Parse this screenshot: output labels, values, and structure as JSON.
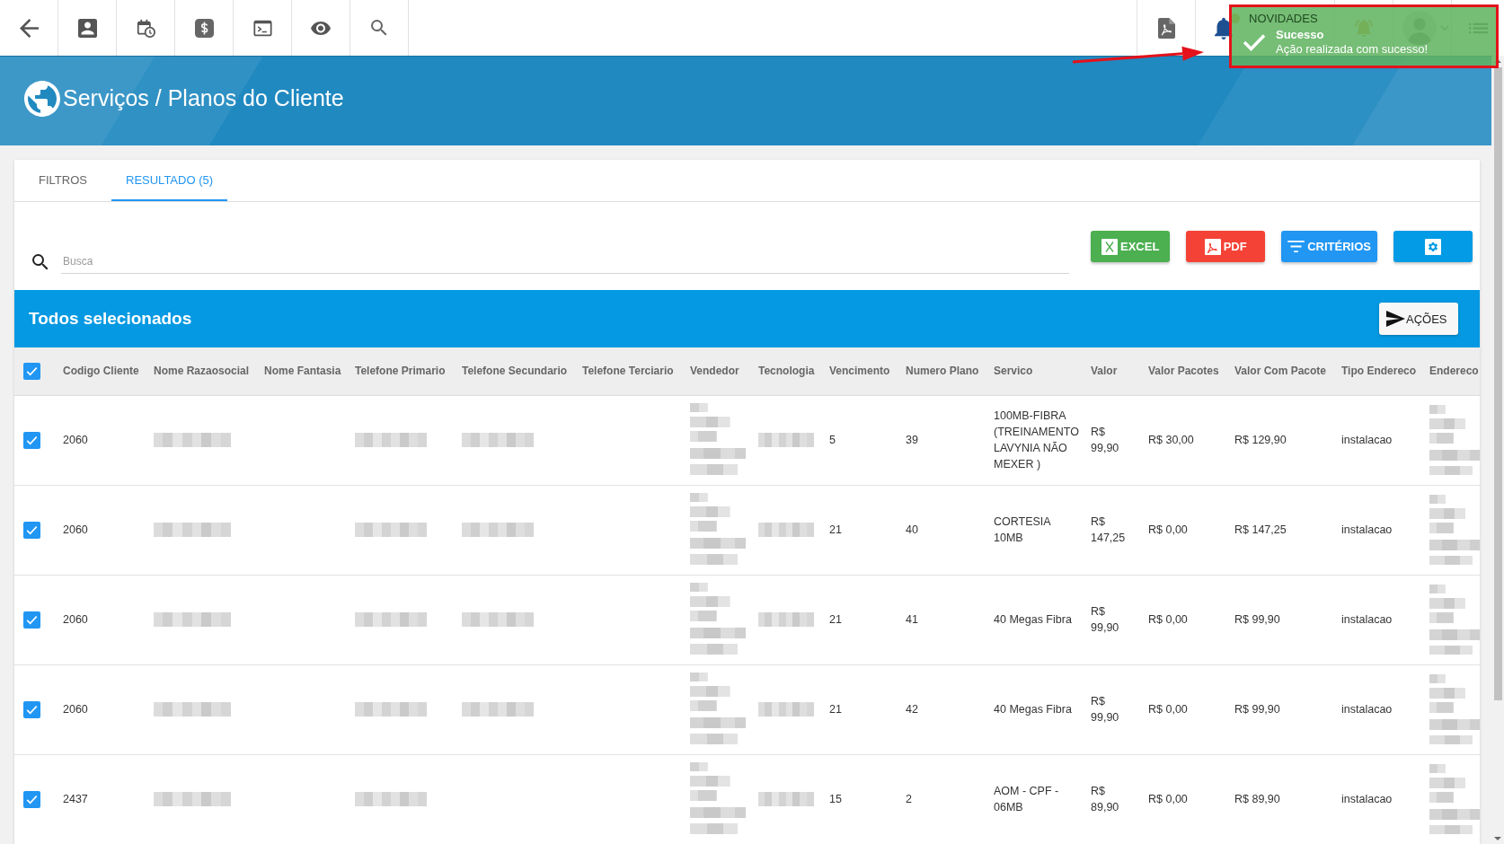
{
  "topbar": {
    "news_label": "NOVIDADES"
  },
  "toast": {
    "title": "Sucesso",
    "message": "Ação realizada com sucesso!"
  },
  "page_title": "Serviços / Planos do Cliente",
  "tabs": [
    {
      "label": "FILTROS",
      "selected": false
    },
    {
      "label": "RESULTADO (5)",
      "selected": true
    }
  ],
  "search": {
    "placeholder": "Busca"
  },
  "actions": [
    {
      "kind": "excel",
      "label": "EXCEL"
    },
    {
      "kind": "pdf",
      "label": "PDF"
    },
    {
      "kind": "criteria",
      "label": "CRITÉRIOS"
    },
    {
      "kind": "settings"
    }
  ],
  "selection_bar": {
    "title": "Todos selecionados",
    "button_label": "AÇÕES"
  },
  "table": {
    "select_all": {
      "checked": true
    },
    "columns": [
      "Codigo Cliente",
      "Nome Razaosocial",
      "Nome Fantasia",
      "Telefone Primario",
      "Telefone Secundario",
      "Telefone Terciario",
      "Vendedor",
      "Tecnologia",
      "Vencimento",
      "Numero Plano",
      "Servico",
      "Valor",
      "Valor Pacotes",
      "Valor Com Pacote",
      "Tipo Endereco",
      "Endereco"
    ],
    "rows": [
      {
        "checked": true,
        "cells": [
          {
            "kind": "text",
            "text": "2060"
          },
          {
            "kind": "blurred"
          },
          null,
          {
            "kind": "blurred"
          },
          {
            "kind": "blurred"
          },
          null,
          {
            "kind": "blurred_lines"
          },
          {
            "kind": "blurred"
          },
          {
            "kind": "text",
            "text": "5"
          },
          {
            "kind": "text",
            "text": "39"
          },
          {
            "kind": "text",
            "text": "100MB-FIBRA (TREINAMENTO LAVYNIA NÃO MEXER )"
          },
          {
            "kind": "text",
            "text": "R$ 99,90"
          },
          {
            "kind": "text",
            "text": "R$ 30,00"
          },
          {
            "kind": "text",
            "text": "R$ 129,90"
          },
          {
            "kind": "text",
            "text": "instalacao"
          },
          {
            "kind": "blurred_lines"
          }
        ]
      },
      {
        "checked": true,
        "cells": [
          {
            "kind": "text",
            "text": "2060"
          },
          {
            "kind": "blurred"
          },
          null,
          {
            "kind": "blurred"
          },
          {
            "kind": "blurred"
          },
          null,
          {
            "kind": "blurred_lines"
          },
          {
            "kind": "blurred"
          },
          {
            "kind": "text",
            "text": "21"
          },
          {
            "kind": "text",
            "text": "40"
          },
          {
            "kind": "text",
            "text": "CORTESIA 10MB"
          },
          {
            "kind": "text",
            "text": "R$ 147,25"
          },
          {
            "kind": "text",
            "text": "R$ 0,00"
          },
          {
            "kind": "text",
            "text": "R$ 147,25"
          },
          {
            "kind": "text",
            "text": "instalacao"
          },
          {
            "kind": "blurred_lines"
          }
        ]
      },
      {
        "checked": true,
        "cells": [
          {
            "kind": "text",
            "text": "2060"
          },
          {
            "kind": "blurred"
          },
          null,
          {
            "kind": "blurred"
          },
          {
            "kind": "blurred"
          },
          null,
          {
            "kind": "blurred_lines"
          },
          {
            "kind": "blurred"
          },
          {
            "kind": "text",
            "text": "21"
          },
          {
            "kind": "text",
            "text": "41"
          },
          {
            "kind": "text",
            "text": "40 Megas Fibra"
          },
          {
            "kind": "text",
            "text": "R$ 99,90"
          },
          {
            "kind": "text",
            "text": "R$ 0,00"
          },
          {
            "kind": "text",
            "text": "R$ 99,90"
          },
          {
            "kind": "text",
            "text": "instalacao"
          },
          {
            "kind": "blurred_lines"
          }
        ]
      },
      {
        "checked": true,
        "cells": [
          {
            "kind": "text",
            "text": "2060"
          },
          {
            "kind": "blurred"
          },
          null,
          {
            "kind": "blurred"
          },
          {
            "kind": "blurred"
          },
          null,
          {
            "kind": "blurred_lines"
          },
          {
            "kind": "blurred"
          },
          {
            "kind": "text",
            "text": "21"
          },
          {
            "kind": "text",
            "text": "42"
          },
          {
            "kind": "text",
            "text": "40 Megas Fibra"
          },
          {
            "kind": "text",
            "text": "R$ 99,90"
          },
          {
            "kind": "text",
            "text": "R$ 0,00"
          },
          {
            "kind": "text",
            "text": "R$ 99,90"
          },
          {
            "kind": "text",
            "text": "instalacao"
          },
          {
            "kind": "blurred_lines"
          }
        ]
      },
      {
        "checked": true,
        "cells": [
          {
            "kind": "text",
            "text": "2437"
          },
          {
            "kind": "blurred"
          },
          null,
          {
            "kind": "blurred"
          },
          null,
          null,
          {
            "kind": "blurred_lines"
          },
          {
            "kind": "blurred"
          },
          {
            "kind": "text",
            "text": "15"
          },
          {
            "kind": "text",
            "text": "2"
          },
          {
            "kind": "text",
            "text": "AOM - CPF - 06MB"
          },
          {
            "kind": "text",
            "text": "R$ 89,90"
          },
          {
            "kind": "text",
            "text": "R$ 0,00"
          },
          {
            "kind": "text",
            "text": "R$ 89,90"
          },
          {
            "kind": "text",
            "text": "instalacao"
          },
          {
            "kind": "blurred_lines"
          }
        ]
      }
    ]
  }
}
